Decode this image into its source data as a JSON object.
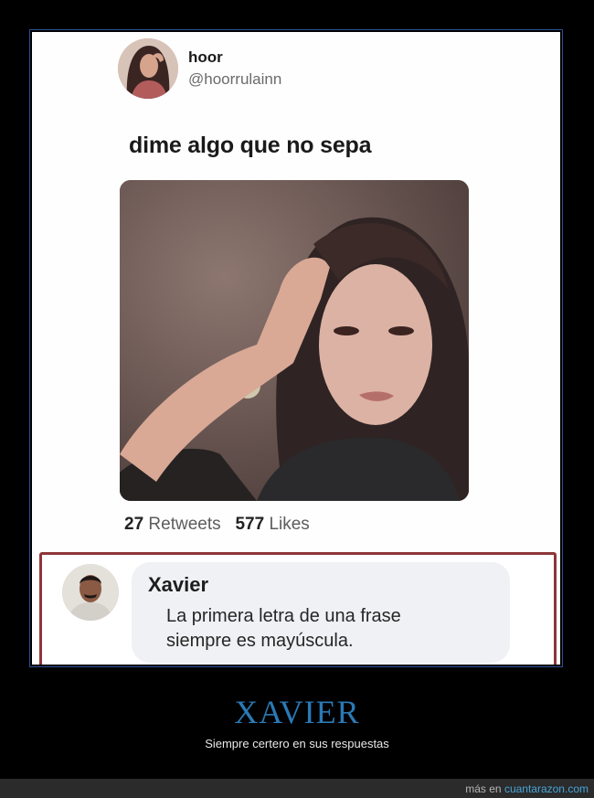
{
  "tweet": {
    "display_name": "hoor",
    "handle": "@hoorrulainn",
    "text": "dime algo que no sepa",
    "retweets_count": "27",
    "retweets_label": "Retweets",
    "likes_count": "577",
    "likes_label": "Likes"
  },
  "reply": {
    "name": "Xavier",
    "line1": "La primera letra de una frase",
    "line2": "siempre es mayúscula."
  },
  "caption": {
    "title": "XAVIER",
    "subtitle": "Siempre certero en sus respuestas"
  },
  "footer": {
    "prefix": "más en",
    "site": "cuantarazon.com"
  },
  "colors": {
    "frame_border": "#2e4f9a",
    "reply_border": "#8e3538",
    "caption_title": "#2a7ab7",
    "footer_link": "#47a5d8"
  }
}
